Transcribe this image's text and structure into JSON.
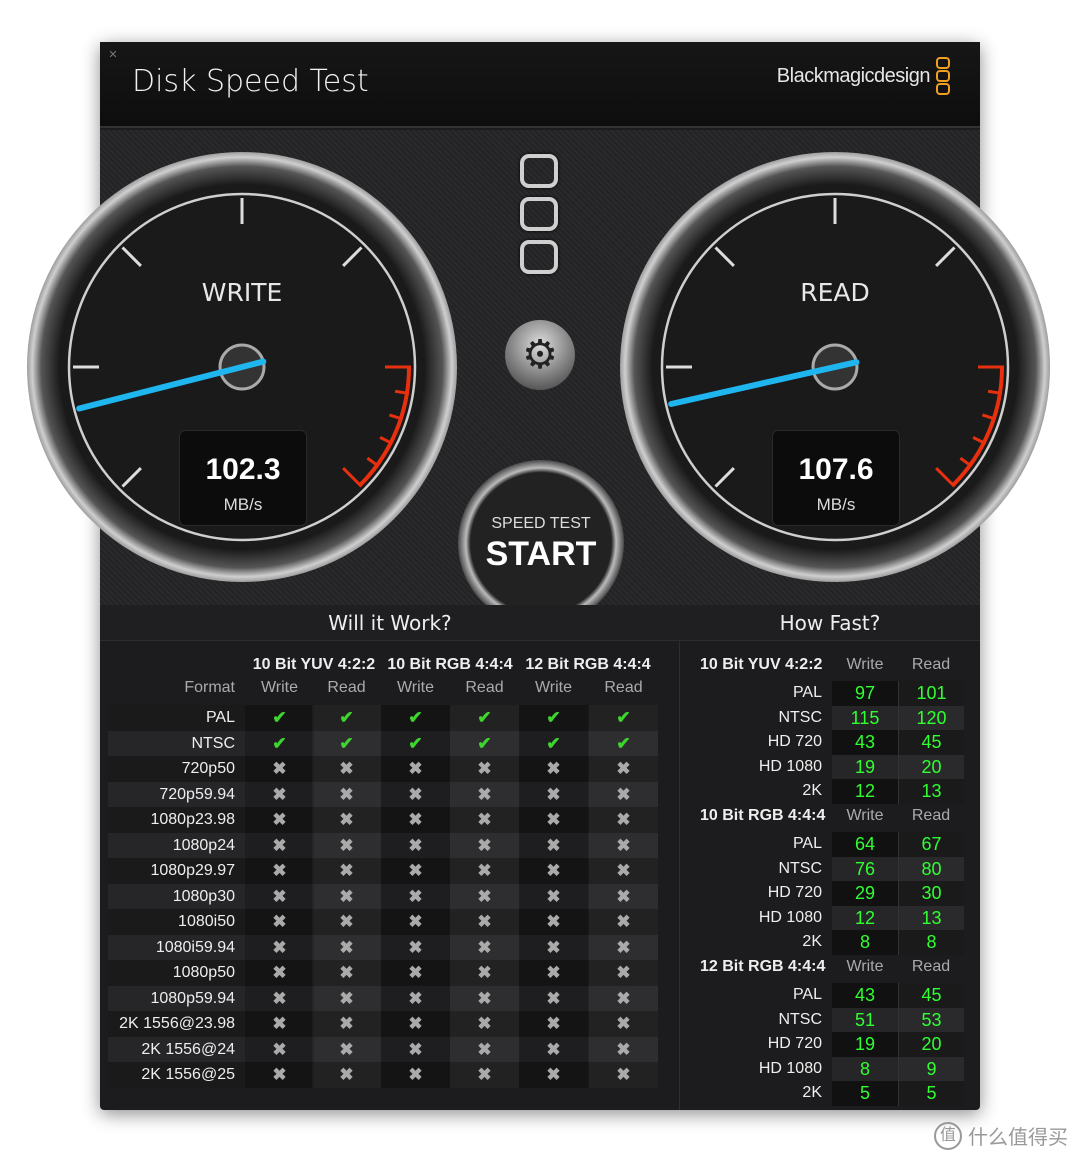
{
  "window": {
    "close_icon": "close-icon",
    "title": "Disk Speed Test",
    "brand": "Blackmagicdesign"
  },
  "gauges": {
    "write": {
      "label": "WRITE",
      "value": "102.3",
      "unit": "MB/s",
      "needle": 102.3
    },
    "read": {
      "label": "READ",
      "value": "107.6",
      "unit": "MB/s",
      "needle": 107.6
    }
  },
  "colors": {
    "needle": "#1fb6f0",
    "redzone": "#e8300f",
    "ok": "#3fd42e",
    "value": "#30ff30",
    "brand": "#f0a020"
  },
  "controls": {
    "settings_icon": "gear-icon",
    "start_top": "SPEED TEST",
    "start_label": "START"
  },
  "will_it_work": {
    "title": "Will it Work?",
    "format_label": "Format",
    "groups": [
      "10 Bit YUV 4:2:2",
      "10 Bit RGB 4:4:4",
      "12 Bit RGB 4:4:4"
    ],
    "subcols": [
      "Write",
      "Read",
      "Write",
      "Read",
      "Write",
      "Read"
    ],
    "rows": [
      {
        "format": "PAL",
        "ok": [
          true,
          true,
          true,
          true,
          true,
          true
        ]
      },
      {
        "format": "NTSC",
        "ok": [
          true,
          true,
          true,
          true,
          true,
          true
        ]
      },
      {
        "format": "720p50",
        "ok": [
          false,
          false,
          false,
          false,
          false,
          false
        ]
      },
      {
        "format": "720p59.94",
        "ok": [
          false,
          false,
          false,
          false,
          false,
          false
        ]
      },
      {
        "format": "1080p23.98",
        "ok": [
          false,
          false,
          false,
          false,
          false,
          false
        ]
      },
      {
        "format": "1080p24",
        "ok": [
          false,
          false,
          false,
          false,
          false,
          false
        ]
      },
      {
        "format": "1080p29.97",
        "ok": [
          false,
          false,
          false,
          false,
          false,
          false
        ]
      },
      {
        "format": "1080p30",
        "ok": [
          false,
          false,
          false,
          false,
          false,
          false
        ]
      },
      {
        "format": "1080i50",
        "ok": [
          false,
          false,
          false,
          false,
          false,
          false
        ]
      },
      {
        "format": "1080i59.94",
        "ok": [
          false,
          false,
          false,
          false,
          false,
          false
        ]
      },
      {
        "format": "1080p50",
        "ok": [
          false,
          false,
          false,
          false,
          false,
          false
        ]
      },
      {
        "format": "1080p59.94",
        "ok": [
          false,
          false,
          false,
          false,
          false,
          false
        ]
      },
      {
        "format": "2K 1556@23.98",
        "ok": [
          false,
          false,
          false,
          false,
          false,
          false
        ]
      },
      {
        "format": "2K 1556@24",
        "ok": [
          false,
          false,
          false,
          false,
          false,
          false
        ]
      },
      {
        "format": "2K 1556@25",
        "ok": [
          false,
          false,
          false,
          false,
          false,
          false
        ]
      }
    ]
  },
  "how_fast": {
    "title": "How Fast?",
    "write_label": "Write",
    "read_label": "Read",
    "groups": [
      {
        "name": "10 Bit YUV 4:2:2",
        "rows": [
          [
            "PAL",
            "97",
            "101"
          ],
          [
            "NTSC",
            "115",
            "120"
          ],
          [
            "HD 720",
            "43",
            "45"
          ],
          [
            "HD 1080",
            "19",
            "20"
          ],
          [
            "2K",
            "12",
            "13"
          ]
        ]
      },
      {
        "name": "10 Bit RGB 4:4:4",
        "rows": [
          [
            "PAL",
            "64",
            "67"
          ],
          [
            "NTSC",
            "76",
            "80"
          ],
          [
            "HD 720",
            "29",
            "30"
          ],
          [
            "HD 1080",
            "12",
            "13"
          ],
          [
            "2K",
            "8",
            "8"
          ]
        ]
      },
      {
        "name": "12 Bit RGB 4:4:4",
        "rows": [
          [
            "PAL",
            "43",
            "45"
          ],
          [
            "NTSC",
            "51",
            "53"
          ],
          [
            "HD 720",
            "19",
            "20"
          ],
          [
            "HD 1080",
            "8",
            "9"
          ],
          [
            "2K",
            "5",
            "5"
          ]
        ]
      }
    ]
  },
  "watermark": "什么值得买"
}
